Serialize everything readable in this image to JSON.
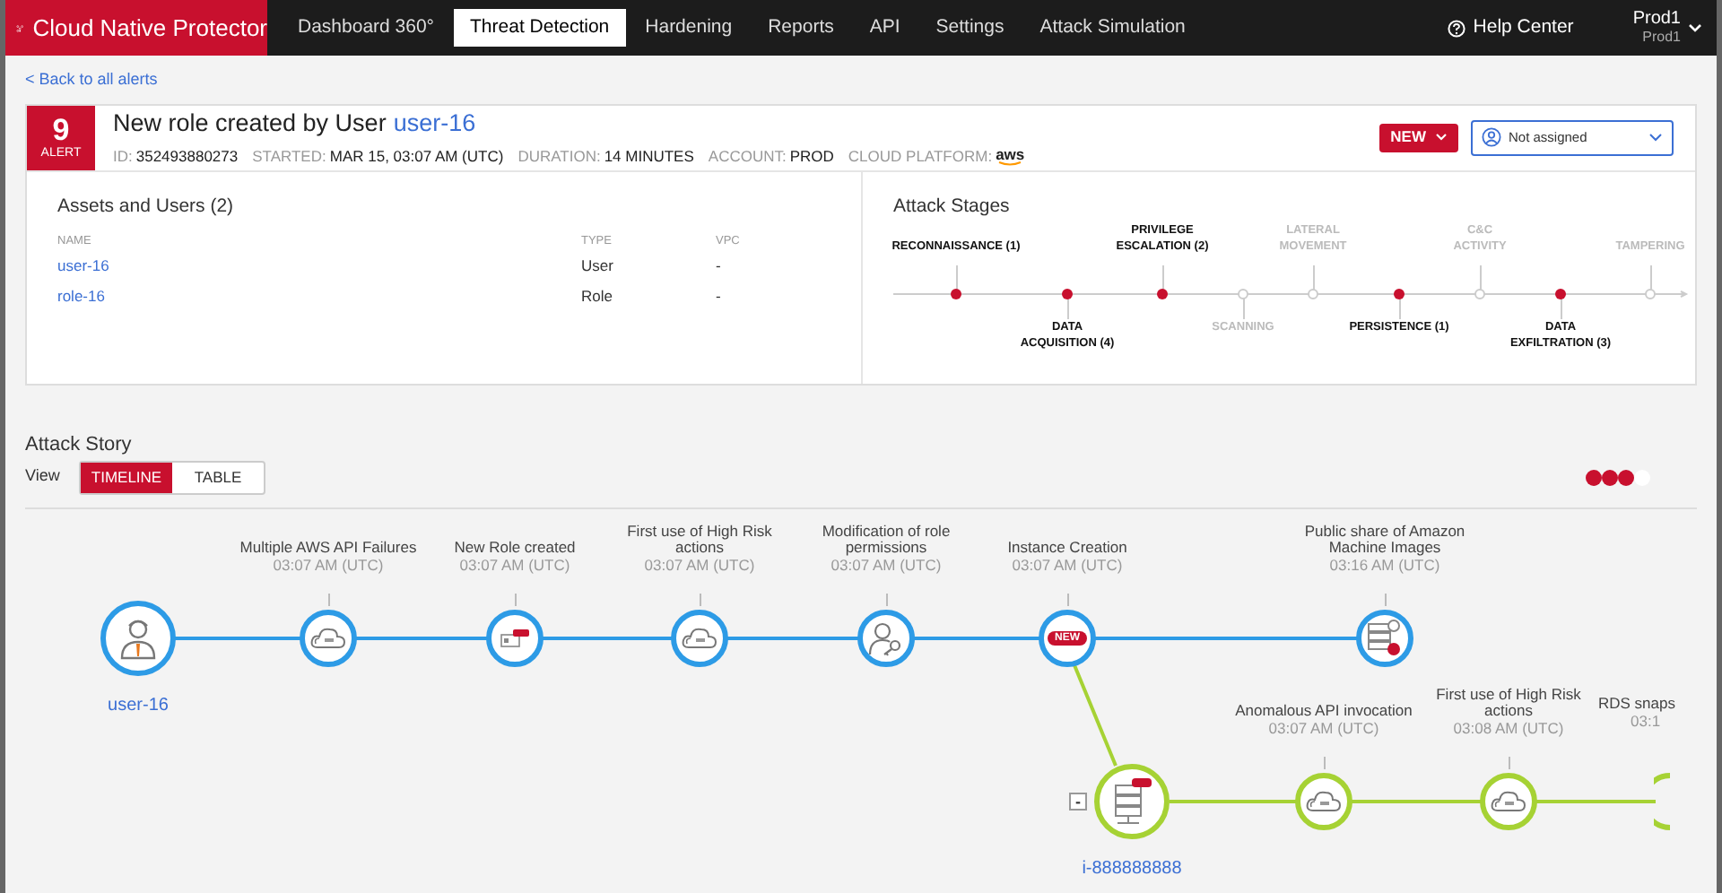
{
  "nav": {
    "brand": "Cloud Native Protector",
    "tabs": [
      {
        "label": "Dashboard 360°",
        "selected": false
      },
      {
        "label": "Threat Detection",
        "selected": true
      },
      {
        "label": "Hardening",
        "selected": false
      },
      {
        "label": "Reports",
        "selected": false
      },
      {
        "label": "API",
        "selected": false
      },
      {
        "label": "Settings",
        "selected": false
      },
      {
        "label": "Attack Simulation",
        "selected": false
      }
    ],
    "help": "Help Center",
    "account": {
      "name": "Prod1",
      "sub": "Prod1"
    }
  },
  "back_link": "< Back to all alerts",
  "alert": {
    "count": "9",
    "badge_label": "ALERT",
    "title": "New role created by User",
    "title_link": "user-16",
    "meta": [
      {
        "kind": "text",
        "label": "ID:",
        "value": "352493880273"
      },
      {
        "kind": "text",
        "label": "STARTED:",
        "value": "MAR 15, 03:07 AM (UTC)"
      },
      {
        "kind": "text",
        "label": "DURATION:",
        "value": "14 MINUTES"
      },
      {
        "kind": "text",
        "label": "ACCOUNT:",
        "value": "PROD"
      },
      {
        "kind": "logo",
        "label": "CLOUD PLATFORM:",
        "value": "aws"
      }
    ],
    "status_button": "NEW",
    "assignee": "Not assigned"
  },
  "assets": {
    "title": "Assets and Users (2)",
    "columns": [
      "NAME",
      "TYPE",
      "VPC"
    ],
    "rows": [
      [
        "user-16",
        "User",
        "-"
      ],
      [
        "role-16",
        "Role",
        "-"
      ]
    ]
  },
  "stages": {
    "title": "Attack Stages",
    "items": [
      {
        "lines": [
          "RECONNAISSANCE (1)"
        ],
        "active": true
      },
      {
        "lines": [
          "DATA",
          "ACQUISITION (4)"
        ],
        "active": true
      },
      {
        "lines": [
          "PRIVILEGE",
          "ESCALATION (2)"
        ],
        "active": true
      },
      {
        "lines": [
          "SCANNING"
        ],
        "active": false
      },
      {
        "lines": [
          "LATERAL",
          "MOVEMENT"
        ],
        "active": false
      },
      {
        "lines": [
          "PERSISTENCE (1)"
        ],
        "active": true
      },
      {
        "lines": [
          "C&C",
          "ACTIVITY"
        ],
        "active": false
      },
      {
        "lines": [
          "DATA",
          "EXFILTRATION (3)"
        ],
        "active": true
      },
      {
        "lines": [
          "TAMPERING"
        ],
        "active": false
      }
    ]
  },
  "story": {
    "title": "Attack Story",
    "view_label": "View",
    "views": [
      {
        "label": "TIMELINE",
        "selected": true
      },
      {
        "label": "TABLE",
        "selected": false
      }
    ],
    "severity": {
      "stars": 3
    },
    "main": [
      {
        "kind": "user",
        "label": "user-16"
      },
      {
        "kind": "api",
        "lines": [
          "Multiple AWS API Failures"
        ],
        "time": "03:07 AM (UTC)"
      },
      {
        "kind": "role",
        "lines": [
          "New Role created"
        ],
        "time": "03:07 AM (UTC)"
      },
      {
        "kind": "api",
        "lines": [
          "First use of High Risk",
          "actions"
        ],
        "time": "03:07 AM (UTC)"
      },
      {
        "kind": "permission",
        "lines": [
          "Modification of role",
          "permissions"
        ],
        "time": "03:07 AM (UTC)"
      },
      {
        "kind": "new",
        "lines": [
          "Instance Creation"
        ],
        "time": "03:07 AM (UTC)",
        "badge": "NEW"
      },
      {
        "kind": "ami",
        "lines": [
          "Public share of Amazon",
          "Machine Images"
        ],
        "time": "03:16 AM (UTC)"
      }
    ],
    "branch": [
      {
        "kind": "instance",
        "label": "i-888888888",
        "collapse": "-"
      },
      {
        "kind": "api",
        "lines": [
          "Anomalous API invocation"
        ],
        "time": "03:07 AM (UTC)"
      },
      {
        "kind": "api",
        "lines": [
          "First use of High Risk",
          "actions"
        ],
        "time": "03:08 AM (UTC)"
      },
      {
        "kind": "partial",
        "lines": [
          "RDS snaps"
        ],
        "time": "03:1"
      }
    ]
  }
}
